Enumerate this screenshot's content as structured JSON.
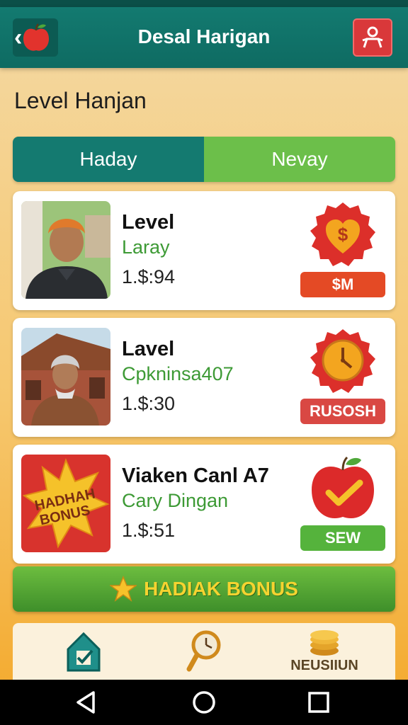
{
  "app": {
    "title": "Desal Harigan"
  },
  "header": {
    "back_icon": "apple-icon",
    "profile_icon": "person-icon"
  },
  "page": {
    "heading": "Level Hanjan"
  },
  "tabs": [
    {
      "label": "Haday",
      "active": true
    },
    {
      "label": "Nevay",
      "active": false
    }
  ],
  "cards": [
    {
      "title": "Level",
      "subtitle": "Laray",
      "price": "1.$:94",
      "badge_icon": "dollar-heart-icon",
      "action": "$M",
      "action_color": "#e44a25"
    },
    {
      "title": "Lavel",
      "subtitle": "Cpkninsa407",
      "price": "1.$:30",
      "badge_icon": "clock-icon",
      "action": "RUSOSH",
      "action_color": "#d94843"
    },
    {
      "title": "Viaken Canl A7",
      "subtitle": "Cary Dingan",
      "price": "1.$:51",
      "badge_icon": "apple-check-icon",
      "action": "SEW",
      "action_color": "#55b33c",
      "thumb_text": "HADHAH BONUS"
    }
  ],
  "bonus_button": {
    "label": "HADIAK BONUS"
  },
  "bottom_nav": [
    {
      "icon": "home-icon",
      "label": ""
    },
    {
      "icon": "search-clock-icon",
      "label": ""
    },
    {
      "icon": "coins-icon",
      "label": "NEUSIIUN"
    }
  ]
}
